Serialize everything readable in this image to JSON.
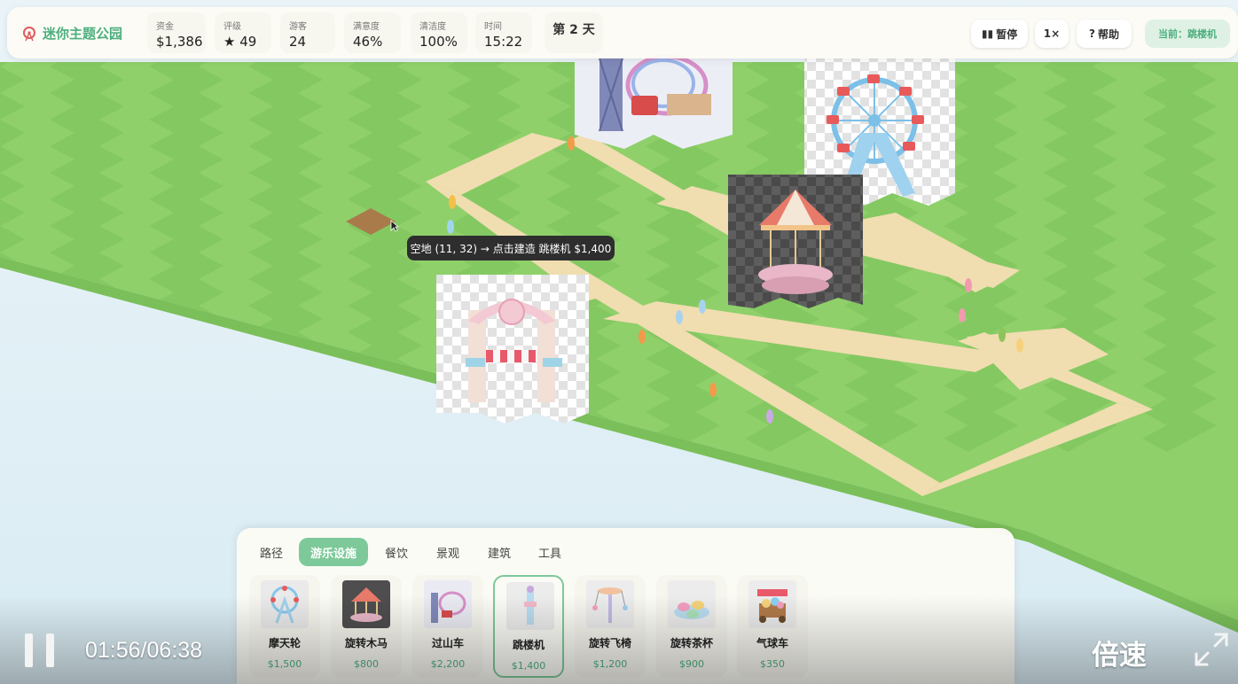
{
  "game": {
    "title": "迷你主题公园",
    "stats": [
      {
        "label": "资金",
        "value": "$1,386"
      },
      {
        "label": "评级",
        "value": "★ 49"
      },
      {
        "label": "游客",
        "value": "24"
      },
      {
        "label": "满意度",
        "value": "46%"
      },
      {
        "label": "清洁度",
        "value": "100%"
      },
      {
        "label": "时间",
        "value": "15:22"
      }
    ],
    "day": "第 2 天",
    "buttons": {
      "pause": "暂停",
      "speed": "1×",
      "help": "帮助"
    },
    "current": "当前：跳楼机"
  },
  "tooltip": "空地 (11, 32) → 点击建造 跳楼机 $1,400",
  "build_panel": {
    "tabs": [
      "路径",
      "游乐设施",
      "餐饮",
      "景观",
      "建筑",
      "工具"
    ],
    "active_tab": 1,
    "items": [
      {
        "name": "摩天轮",
        "price": "$1,500",
        "icon": "ferris-wheel"
      },
      {
        "name": "旋转木马",
        "price": "$800",
        "icon": "carousel"
      },
      {
        "name": "过山车",
        "price": "$2,200",
        "icon": "roller-coaster"
      },
      {
        "name": "跳楼机",
        "price": "$1,400",
        "icon": "drop-tower"
      },
      {
        "name": "旋转飞椅",
        "price": "$1,200",
        "icon": "swing-ride"
      },
      {
        "name": "旋转茶杯",
        "price": "$900",
        "icon": "tea-cups"
      },
      {
        "name": "气球车",
        "price": "$350",
        "icon": "balloon-cart"
      }
    ],
    "selected_item": 3
  },
  "video": {
    "time": "01:56/06:38",
    "speed": "倍速"
  },
  "colors": {
    "accent": "#7dc99a",
    "grass": "#8fd06a",
    "path": "#f0ddb0",
    "hud_bg": "#fcfbf5"
  }
}
